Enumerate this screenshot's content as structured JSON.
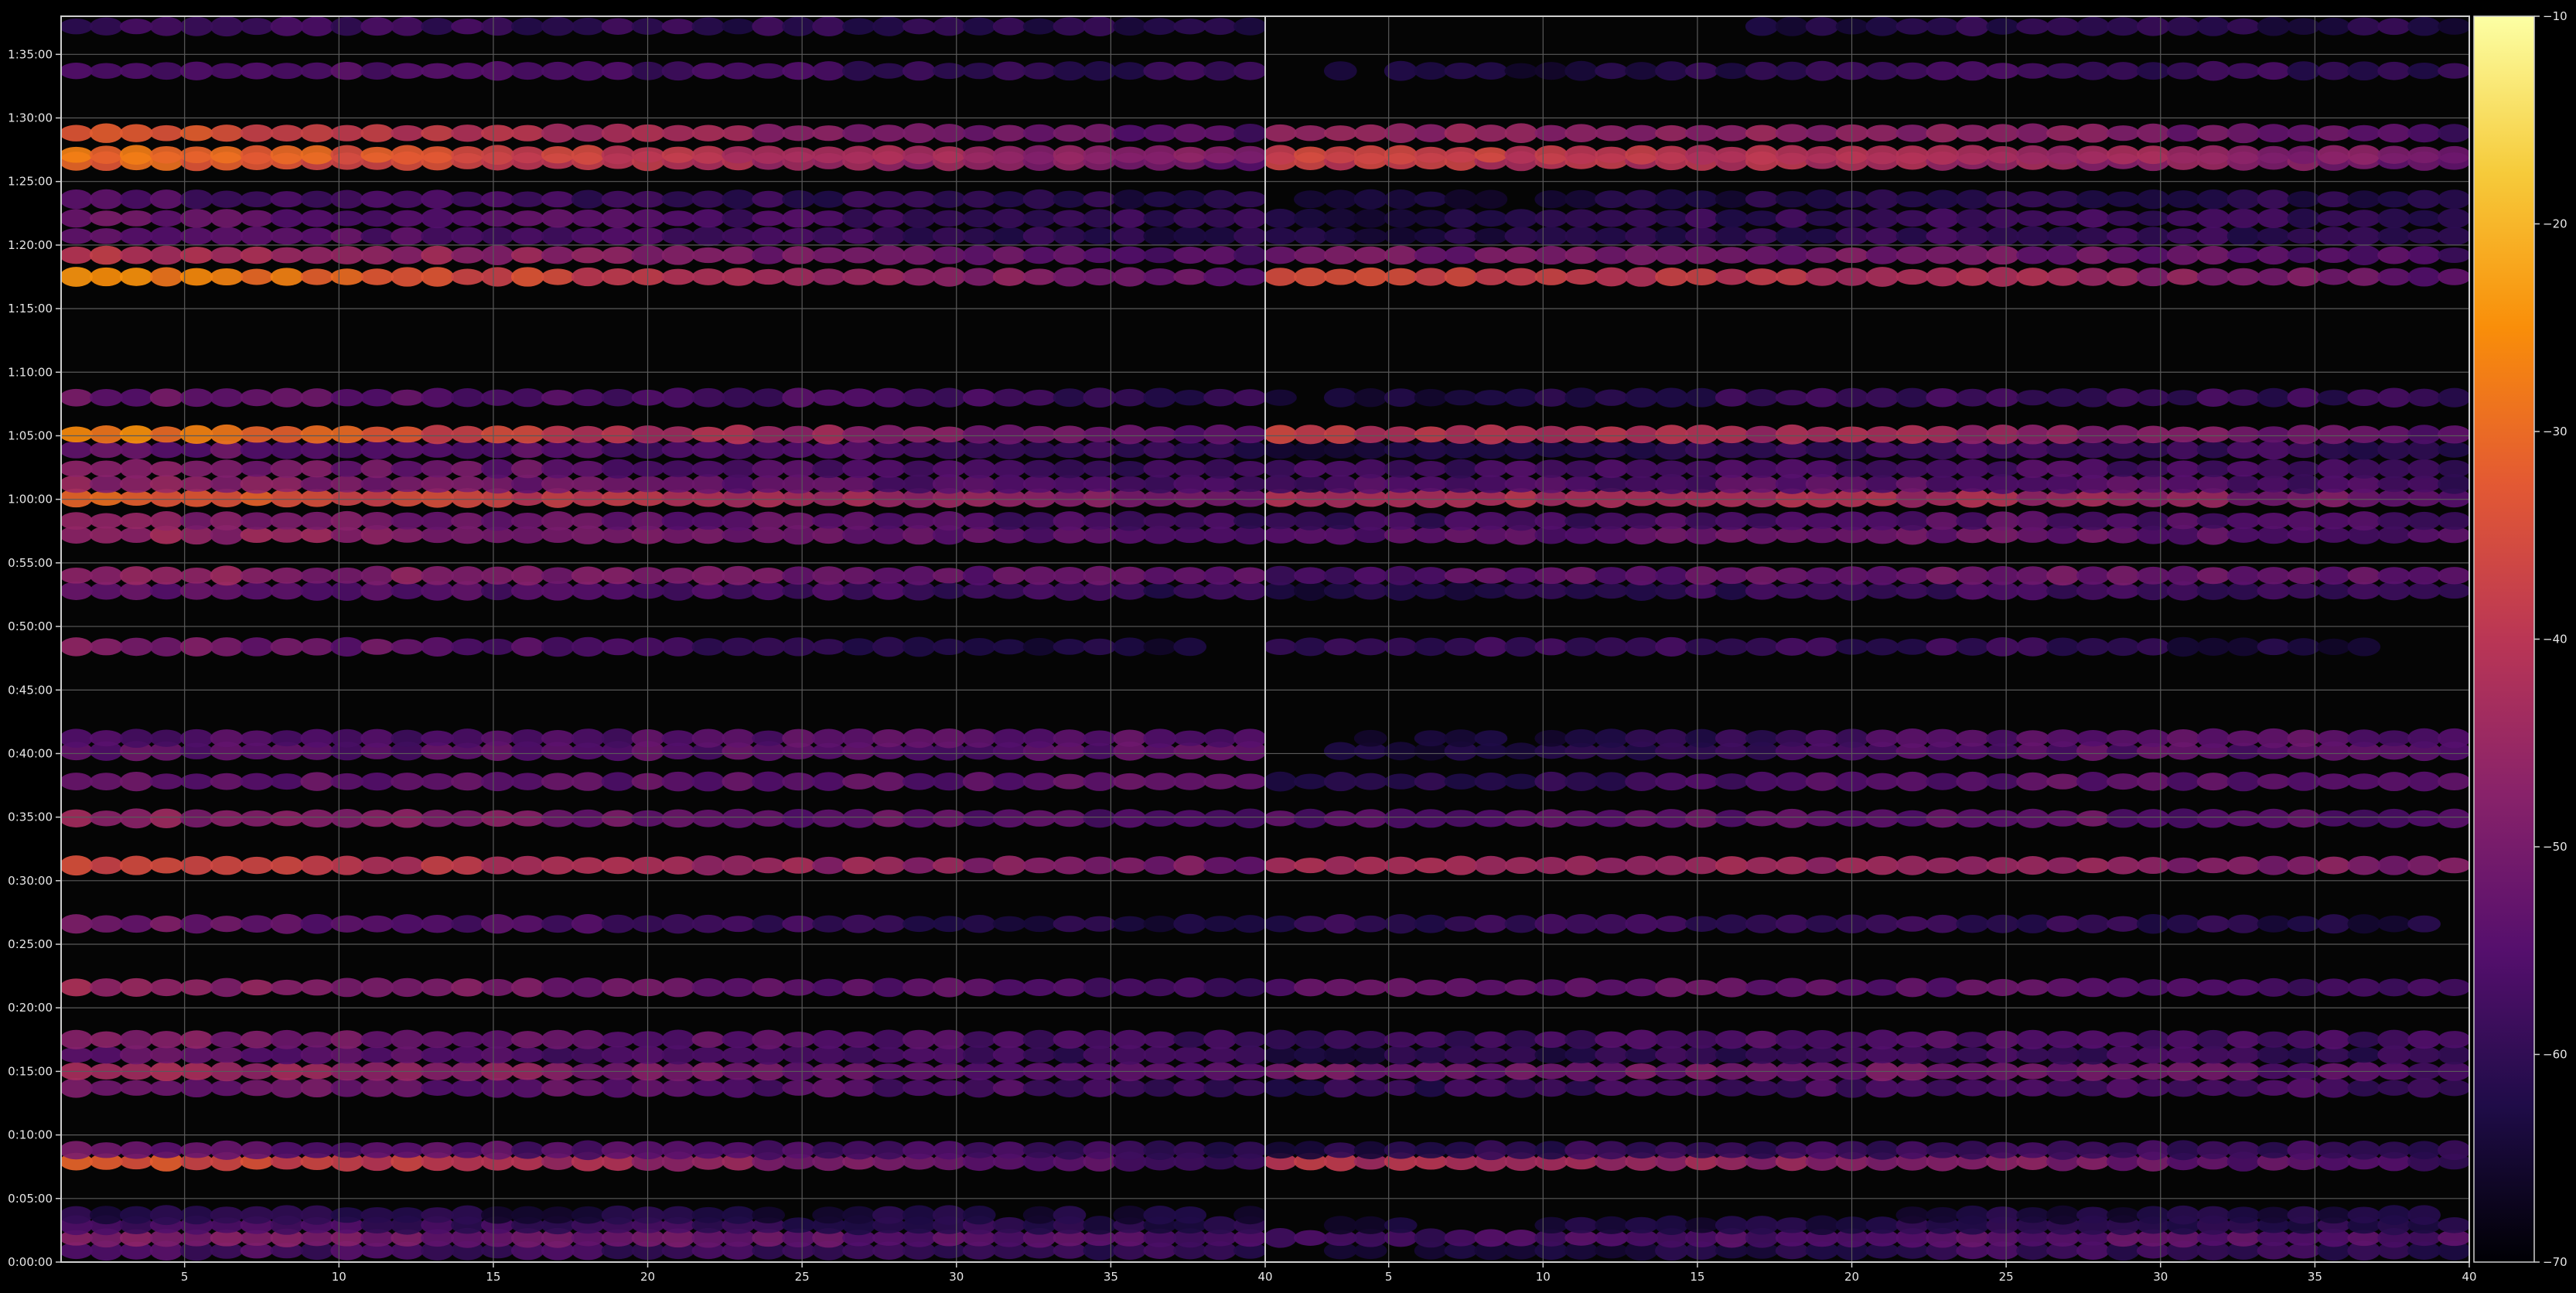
{
  "chart_data": {
    "type": "heatmap",
    "title": "",
    "xlabel": "",
    "ylabel": "",
    "panels": [
      {
        "name": "",
        "x_range": [
          1,
          40
        ],
        "x_ticks": [
          5,
          10,
          15,
          20,
          25,
          30,
          35,
          40
        ]
      },
      {
        "name": "",
        "x_range": [
          1,
          40
        ],
        "x_ticks": [
          5,
          10,
          15,
          20,
          25,
          30,
          35,
          40
        ]
      }
    ],
    "y_ticks": [
      "0:00:00",
      "0:05:00",
      "0:10:00",
      "0:15:00",
      "0:20:00",
      "0:25:00",
      "0:30:00",
      "0:35:00",
      "0:40:00",
      "0:45:00",
      "0:50:00",
      "0:55:00",
      "1:00:00",
      "1:05:00",
      "1:10:00",
      "1:15:00",
      "1:20:00",
      "1:25:00",
      "1:30:00",
      "1:35:00"
    ],
    "y_range_minutes": [
      0,
      98
    ],
    "grid": true,
    "colormap": "inferno",
    "colorbar": {
      "range": [
        -70,
        -10
      ],
      "ticks": [
        -10,
        -20,
        -30,
        -40,
        -50,
        -60,
        -70
      ]
    },
    "bands": [
      {
        "t": 0.9,
        "l": -56,
        "r": -60,
        "g": 0.25
      },
      {
        "t": 1.9,
        "l": -48,
        "r": -56,
        "g": 0.22
      },
      {
        "t": 2.9,
        "l": -56,
        "r": -62,
        "g": 0.2
      },
      {
        "t": 3.7,
        "l": -62,
        "r": -64,
        "g": 0.15
      },
      {
        "t": 7.9,
        "l": -32,
        "r": -58,
        "g": 0.4
      },
      {
        "t": 8.8,
        "l": -52,
        "r": -60,
        "g": 0.28
      },
      {
        "t": 13.7,
        "l": -50,
        "r": -58,
        "g": 0.2
      },
      {
        "t": 15.0,
        "l": -42,
        "r": -56,
        "g": 0.38
      },
      {
        "t": 16.3,
        "l": -52,
        "r": -60,
        "g": 0.22
      },
      {
        "t": 17.5,
        "l": -48,
        "r": -58,
        "g": 0.25
      },
      {
        "t": 21.6,
        "l": -44,
        "r": -58,
        "g": 0.3
      },
      {
        "t": 26.6,
        "l": -50,
        "r": -64,
        "g": 0.3
      },
      {
        "t": 31.2,
        "l": -36,
        "r": -50,
        "g": 0.55
      },
      {
        "t": 34.9,
        "l": -46,
        "r": -56,
        "g": 0.4
      },
      {
        "t": 37.8,
        "l": -52,
        "r": -54,
        "g": 0.15
      },
      {
        "t": 40.2,
        "l": -54,
        "r": -54,
        "g": 0.12
      },
      {
        "t": 41.2,
        "l": -56,
        "r": -54,
        "g": 0.12
      },
      {
        "t": 48.4,
        "l": -48,
        "r": -66,
        "g": 0.2
      },
      {
        "t": 52.8,
        "l": -52,
        "r": -60,
        "g": 0.22
      },
      {
        "t": 54.0,
        "l": -46,
        "r": -54,
        "g": 0.3
      },
      {
        "t": 57.2,
        "l": -44,
        "r": -56,
        "g": 0.25
      },
      {
        "t": 58.3,
        "l": -48,
        "r": -58,
        "g": 0.22
      },
      {
        "t": 60.1,
        "l": -30,
        "r": -52,
        "g": 0.3
      },
      {
        "t": 61.2,
        "l": -46,
        "r": -58,
        "g": 0.22
      },
      {
        "t": 62.4,
        "l": -48,
        "r": -60,
        "g": 0.25
      },
      {
        "t": 63.9,
        "l": -52,
        "r": -60,
        "g": 0.2
      },
      {
        "t": 65.1,
        "l": -26,
        "r": -56,
        "g": 0.1
      },
      {
        "t": 68.0,
        "l": -52,
        "r": -60,
        "g": 0.15
      },
      {
        "t": 77.5,
        "l": -24,
        "r": -54,
        "g": 0.22
      },
      {
        "t": 79.2,
        "l": -40,
        "r": -56,
        "g": 0.25
      },
      {
        "t": 80.7,
        "l": -52,
        "r": -62,
        "g": 0.18
      },
      {
        "t": 82.1,
        "l": -52,
        "r": -60,
        "g": 0.18
      },
      {
        "t": 83.6,
        "l": -55,
        "r": -62,
        "g": 0.15
      },
      {
        "t": 86.6,
        "l": -30,
        "r": -52,
        "g": 0.4
      },
      {
        "t": 87.1,
        "l": -28,
        "r": -50,
        "g": 0.4
      },
      {
        "t": 88.8,
        "l": -32,
        "r": -56,
        "g": 0.12
      },
      {
        "t": 93.7,
        "l": -54,
        "r": -60,
        "g": 0.15
      },
      {
        "t": 97.2,
        "l": -58,
        "r": -62,
        "g": 0.1
      }
    ]
  }
}
